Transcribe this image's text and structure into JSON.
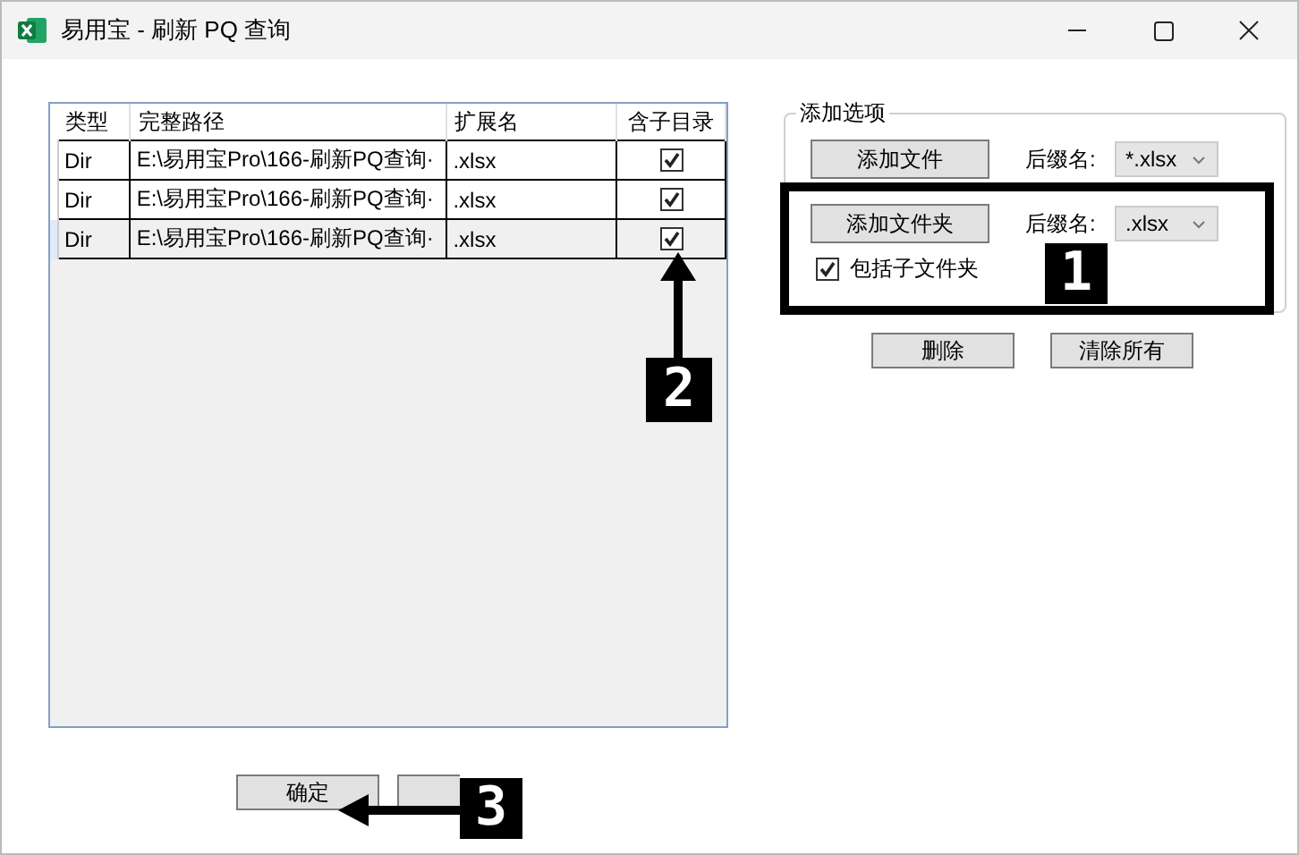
{
  "window": {
    "title": "易用宝 - 刷新 PQ 查询"
  },
  "table": {
    "columns": [
      "类型",
      "完整路径",
      "扩展名",
      "含子目录"
    ],
    "rows": [
      {
        "type": "Dir",
        "path": "E:\\易用宝Pro\\166-刷新PQ查询·",
        "ext": ".xlsx",
        "checked": true,
        "selected": false
      },
      {
        "type": "Dir",
        "path": "E:\\易用宝Pro\\166-刷新PQ查询·",
        "ext": ".xlsx",
        "checked": true,
        "selected": false
      },
      {
        "type": "Dir",
        "path": "E:\\易用宝Pro\\166-刷新PQ查询·",
        "ext": ".xlsx",
        "checked": true,
        "selected": true
      }
    ]
  },
  "options": {
    "title": "添加选项",
    "file_button": "添加文件",
    "file_suffix_label": "后缀名:",
    "file_suffix": "*.xlsx",
    "folder_button": "添加文件夹",
    "folder_suffix_label": "后缀名:",
    "folder_suffix": ".xlsx",
    "include_subfolders": {
      "label": "包括子文件夹",
      "checked": true
    }
  },
  "actions": [
    "删除",
    "清除所有"
  ],
  "footer": {
    "ok": "确定"
  },
  "annotations": [
    {
      "label": "1"
    },
    {
      "label": "2"
    },
    {
      "label": "3"
    }
  ]
}
